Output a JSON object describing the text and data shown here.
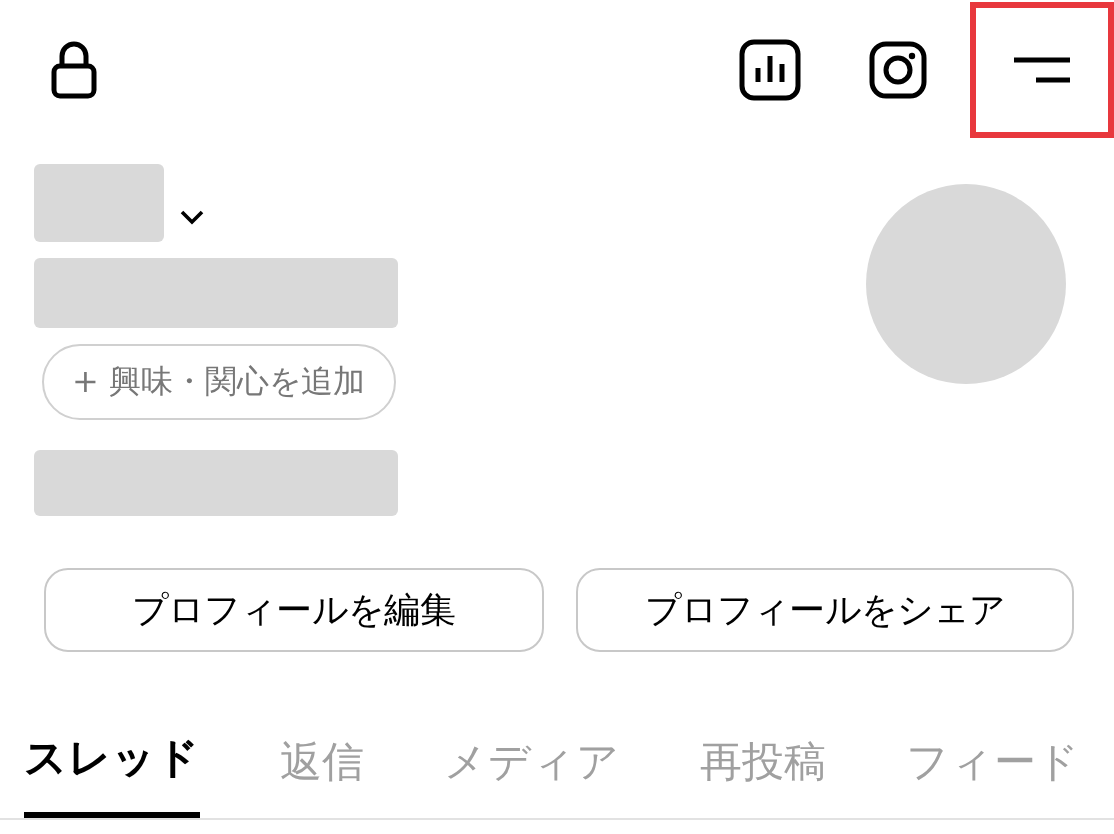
{
  "top_bar": {
    "icons": [
      {
        "kind": "lock",
        "highlighted": false
      },
      {
        "kind": "chart",
        "highlighted": false
      },
      {
        "kind": "camera",
        "highlighted": false
      },
      {
        "kind": "menu",
        "highlighted": true
      }
    ]
  },
  "profile": {
    "interest_button": "+ 興味・関心を追加"
  },
  "buttons": [
    "プロフィールを編集",
    "プロフィールをシェア"
  ],
  "tabs": [
    {
      "label": "スレッド",
      "selected": true
    },
    {
      "label": "返信",
      "selected": false
    },
    {
      "label": "メディア",
      "selected": false
    },
    {
      "label": "再投稿",
      "selected": false
    },
    {
      "label": "フィード",
      "selected": false
    }
  ]
}
